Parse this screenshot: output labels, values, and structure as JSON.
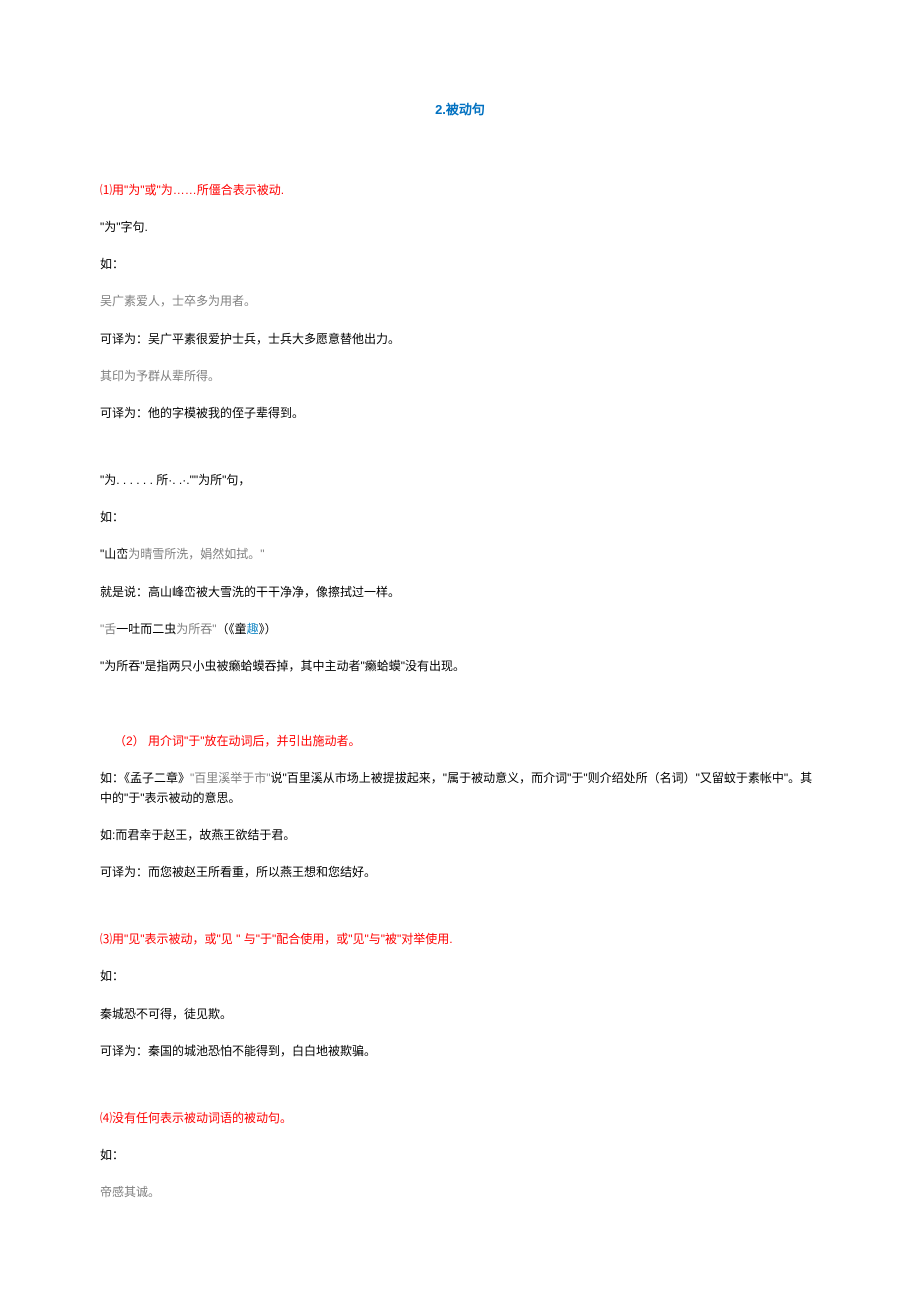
{
  "title": "2.被动句",
  "s1": {
    "heading": "⑴用\"为\"或\"为……所僵合表示被动.",
    "p1": "\"为\"字句.",
    "p2": "如：",
    "ex1": "吴广素爱人，士卒多为用者。",
    "tr1": "可译为：吴广平素很爱护士兵，士兵大多愿意替他出力。",
    "ex2": "其印为予群从辈所得。",
    "tr2": "可译为：他的字模被我的侄子辈得到。",
    "p3": "\"为. . . . . . 所·. .·.\"\"为所\"句，",
    "p4": "如：",
    "ex3_a": "\"山峦",
    "ex3_b": "为晴雪所洗，娟然如拭。\"",
    "tr3": "就是说：高山峰峦被大雪洗的干干净净，像擦拭过一样。",
    "ex4_a": "\"舌",
    "ex4_b": "一吐而二虫",
    "ex4_c": "为所吞\"",
    "ex4_d": "（《童",
    "ex4_e": "趣",
    "ex4_f": "》）",
    "tr4": "\"为所吞\"是指两只小虫被癞蛤蟆吞掉，其中主动者\"癞蛤蟆\"没有出现。"
  },
  "s2": {
    "heading": "（2） 用介词\"于\"放在动词后，并引出施动者。",
    "p1_a": "如：《孟子二章》",
    "p1_b": "\"百里溪举于市\"",
    "p1_c": "说\"百里溪从市场上被提拔起来，\"属于被动意义，而介词\"于\"则介绍处所（名词）\"又留蚊于素帐中\"。其中的\"于\"表示被动的意思。",
    "p2": "如:而君幸于赵王，故燕王欲结于君。",
    "tr2": "可译为：而您被赵王所看重，所以燕王想和您结好。"
  },
  "s3": {
    "heading": "⑶用\"见\"表示被动，或\"见 \" 与\"于\"配合使用，或\"见\"与\"被\"对举使用.",
    "p1": "如：",
    "p2": "秦城恐不可得，徒见欺。",
    "tr": "可译为：秦国的城池恐怕不能得到，白白地被欺骗。"
  },
  "s4": {
    "heading": "⑷没有任何表示被动词语的被动句。",
    "p1": "如：",
    "ex": "帝感其诚。"
  }
}
